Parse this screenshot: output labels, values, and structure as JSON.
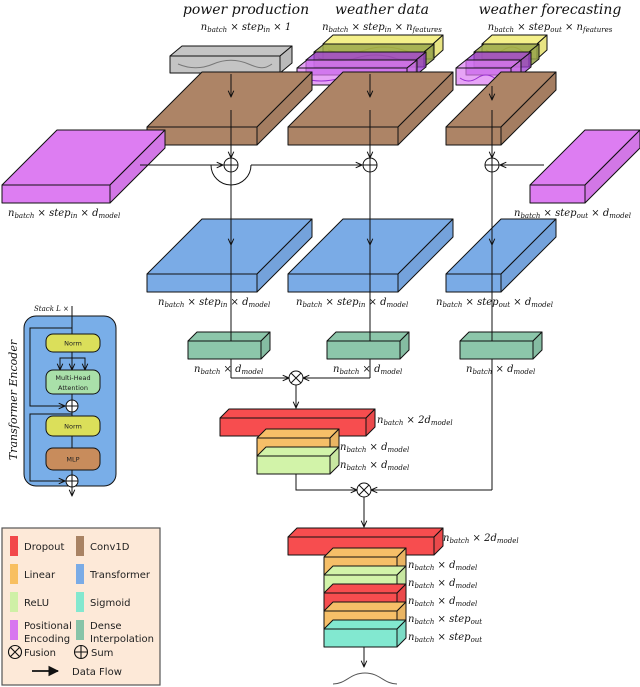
{
  "inputs": {
    "power": {
      "title": "power production",
      "dims": [
        "n",
        "batch",
        " × step",
        "in",
        " × 1"
      ]
    },
    "weather": {
      "title": "weather data",
      "dims": [
        "n",
        "batch",
        " × step",
        "in",
        " × n",
        "features"
      ]
    },
    "forecast": {
      "title": "weather forecasting",
      "dims": [
        "n",
        "batch",
        " × step",
        "out",
        " × n",
        "features"
      ]
    }
  },
  "positional": {
    "left_dims": [
      "n",
      "batch",
      " × step",
      "in",
      " × d",
      "model"
    ],
    "right_dims": [
      "n",
      "batch",
      " × step",
      "out",
      " × d",
      "model"
    ]
  },
  "transformer_dims": {
    "a": [
      "n",
      "batch",
      " × step",
      "in",
      " × d",
      "model"
    ],
    "b": [
      "n",
      "batch",
      " × step",
      "in",
      " × d",
      "model"
    ],
    "c": [
      "n",
      "batch",
      " × step",
      "out",
      " × d",
      "model"
    ]
  },
  "dense_dims": {
    "a": [
      "n",
      "batch",
      " × d",
      "model"
    ],
    "b": [
      "n",
      "batch",
      " × d",
      "model"
    ],
    "c": [
      "n",
      "batch",
      " × d",
      "model"
    ]
  },
  "head1": [
    [
      "n",
      "batch",
      " × 2d",
      "model"
    ],
    [
      "n",
      "batch",
      " × d",
      "model"
    ],
    [
      "n",
      "batch",
      " × d",
      "model"
    ]
  ],
  "head2": [
    [
      "n",
      "batch",
      " × 2d",
      "model"
    ],
    [
      "n",
      "batch",
      " × d",
      "model"
    ],
    [
      "n",
      "batch",
      " × d",
      "model"
    ],
    [
      "n",
      "batch",
      " × d",
      "model"
    ],
    [
      "n",
      "batch",
      " × step",
      "out"
    ],
    [
      "n",
      "batch",
      " × step",
      "out"
    ]
  ],
  "encoder": {
    "title": "Transformer Encoder",
    "stack_label": "Stack L ×",
    "blocks": {
      "norm1": "Norm",
      "mha_line1": "Multi-Head",
      "mha_line2": "Attention",
      "norm2": "Norm",
      "mlp": "MLP"
    }
  },
  "legend": {
    "items": [
      {
        "label": "Dropout",
        "color": "#f2484a"
      },
      {
        "label": "Conv1D",
        "color": "#a98364"
      },
      {
        "label": "Linear",
        "color": "#f8bf60"
      },
      {
        "label": "Transformer",
        "color": "#7aabe6"
      },
      {
        "label": "ReLU",
        "color": "#cff0a6"
      },
      {
        "label": "Sigmoid",
        "color": "#84e8cf"
      },
      {
        "label": "Positional",
        "label2": "Encoding",
        "color": "#d876ef"
      },
      {
        "label": "Dense",
        "label2": "Interpolation",
        "color": "#87c4a8"
      }
    ],
    "fusion": "Fusion",
    "sum": "Sum",
    "flow": "Data Flow"
  },
  "colors": {
    "conv": "#ad8466",
    "transformer": "#7aabe6",
    "positional": "#dd7df2",
    "dense": "#8cc6aa",
    "dropout": "#f74d4f",
    "linear": "#f6bf68",
    "relu": "#d2f3a9",
    "sigmoid": "#82e8d0",
    "input_gray": "#c4c4c4",
    "weather_yellow": "#f4f08a",
    "weather_green": "#9aa84a",
    "weather_purple": "#a33bdc",
    "legend_bg": "#fde9d8",
    "encoder_bg": "#79aee8",
    "norm": "#dbdf5a",
    "mha": "#a9e0a9",
    "mlp": "#c88c5c"
  }
}
